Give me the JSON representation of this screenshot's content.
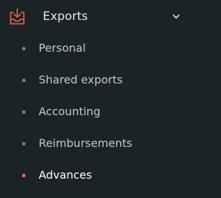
{
  "nav": {
    "section": {
      "label": "Exports",
      "icon": "download-tray-icon",
      "expanded": true,
      "accent_color": "#e8623f"
    },
    "items": [
      {
        "label": "Personal",
        "active": false
      },
      {
        "label": "Shared exports",
        "active": false
      },
      {
        "label": "Accounting",
        "active": false
      },
      {
        "label": "Reimbursements",
        "active": false
      },
      {
        "label": "Advances",
        "active": true
      }
    ]
  }
}
